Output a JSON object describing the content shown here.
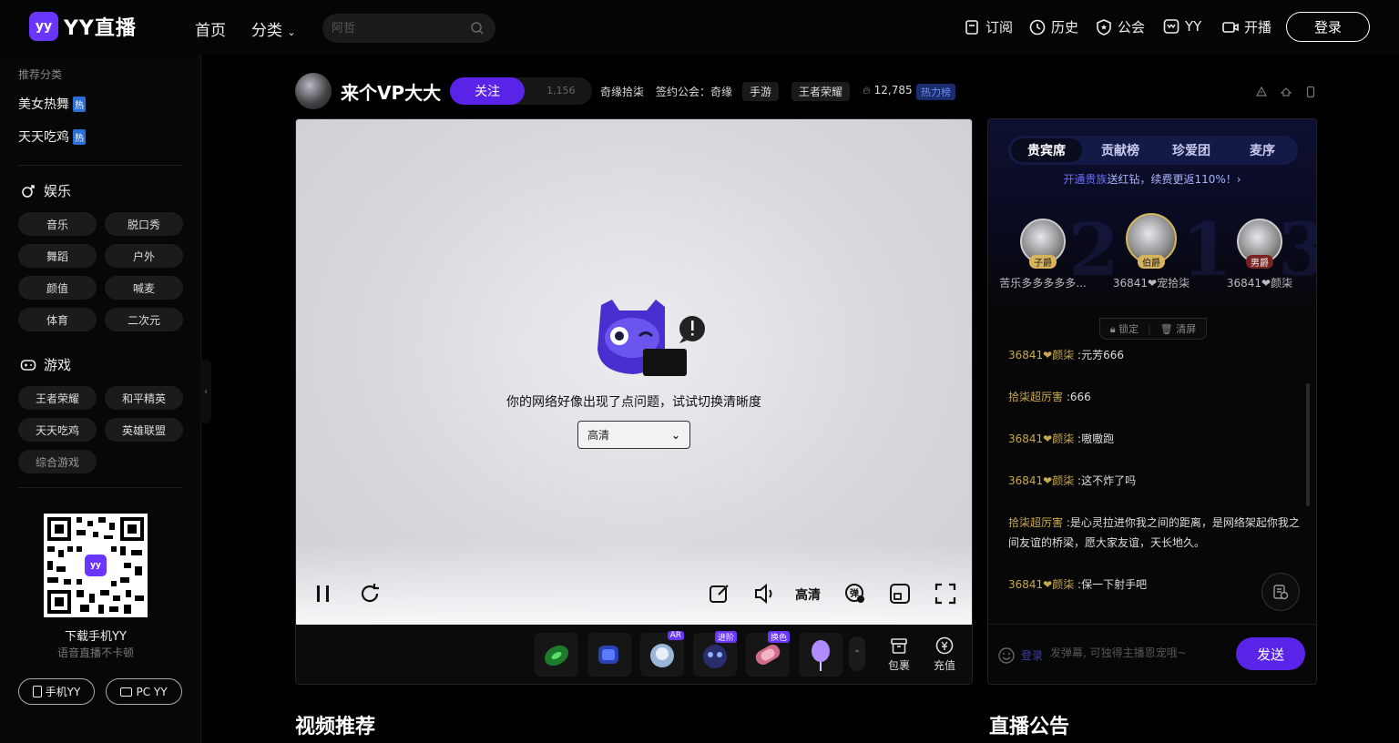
{
  "header": {
    "logo_text": "YY直播",
    "logo_mark": "yy",
    "nav": {
      "home": "首页",
      "category": "分类"
    },
    "search": {
      "placeholder": "阿哲"
    },
    "links": [
      {
        "label": "订阅",
        "icon": "bookmark-icon"
      },
      {
        "label": "历史",
        "icon": "clock-icon"
      },
      {
        "label": "公会",
        "icon": "guild-icon"
      },
      {
        "label": "YY",
        "icon": "yy-icon"
      },
      {
        "label": "开播",
        "icon": "camera-icon"
      }
    ],
    "login": "登录"
  },
  "sidebar": {
    "title": "推荐分类",
    "hot_items": [
      {
        "label": "美女热舞",
        "badge": "热"
      },
      {
        "label": "天天吃鸡",
        "badge": "热"
      }
    ],
    "entertainment": {
      "title": "娱乐",
      "chips": [
        "音乐",
        "脱口秀",
        "舞蹈",
        "户外",
        "颜值",
        "喊麦",
        "体育",
        "二次元"
      ]
    },
    "games": {
      "title": "游戏",
      "chips": [
        "王者荣耀",
        "和平精英",
        "天天吃鸡",
        "英雄联盟",
        "综合游戏"
      ]
    },
    "qr_logo": "yy",
    "download_title": "下载手机YY",
    "download_sub": "语音直播不卡顿",
    "btn_mobile": "手机YY",
    "btn_pc": "PC YY"
  },
  "streamer": {
    "name": "来个VP大大",
    "follow": "关注",
    "fans": "1,156",
    "channel": "奇缘拾柒",
    "guild": "签约公会：奇缘",
    "tag1": "手游",
    "tag2": "王者荣耀",
    "heat": "12,785",
    "heat_rank": "热力榜"
  },
  "player": {
    "error_text": "你的网络好像出现了点问题，试试切换清晰度",
    "quality_selected": "高清",
    "quality_ctrl": "高清",
    "gifts": [
      {
        "name": "gift-1",
        "badge": ""
      },
      {
        "name": "gift-2",
        "badge": ""
      },
      {
        "name": "gift-3",
        "badge": "AR"
      },
      {
        "name": "gift-4",
        "badge": "进阶"
      },
      {
        "name": "gift-5",
        "badge": "换色"
      },
      {
        "name": "gift-6",
        "badge": ""
      }
    ],
    "bag": "包裹",
    "recharge": "充值"
  },
  "rank": {
    "tabs": [
      "贵宾席",
      "贡献榜",
      "珍爱团",
      "麦序"
    ],
    "promo_link": "开通贵族",
    "promo_rest": "送红钻，续费更返110%！",
    "seats": [
      {
        "name": "苦乐多多多多多...",
        "badge": "子爵"
      },
      {
        "name": "36841❤宠拾柒",
        "badge": "伯爵"
      },
      {
        "name": "36841❤颜柒",
        "badge": "男爵"
      }
    ],
    "numbers": [
      "2",
      "1",
      "3"
    ],
    "lock": "锁定",
    "clear": "清屏"
  },
  "chat": [
    {
      "user": "36841❤颜柒",
      "text": "元芳666"
    },
    {
      "user": "拾柒超厉害",
      "text": "666"
    },
    {
      "user": "36841❤颜柒",
      "text": "嗷嗷跑"
    },
    {
      "user": "36841❤颜柒",
      "text": "这不炸了吗"
    },
    {
      "user": "拾柒超厉害",
      "text": "是心灵拉进你我之间的距离，是网络架起你我之间友谊的桥梁，愿大家友谊，天长地久。"
    },
    {
      "user": "36841❤颜柒",
      "text": "保一下射手吧"
    }
  ],
  "input": {
    "tag": "登录",
    "placeholder": "发弹幕, 可独得主播恩宠哦~",
    "send": "发送"
  },
  "sections": {
    "videos": "视频推荐",
    "notice": "直播公告"
  }
}
